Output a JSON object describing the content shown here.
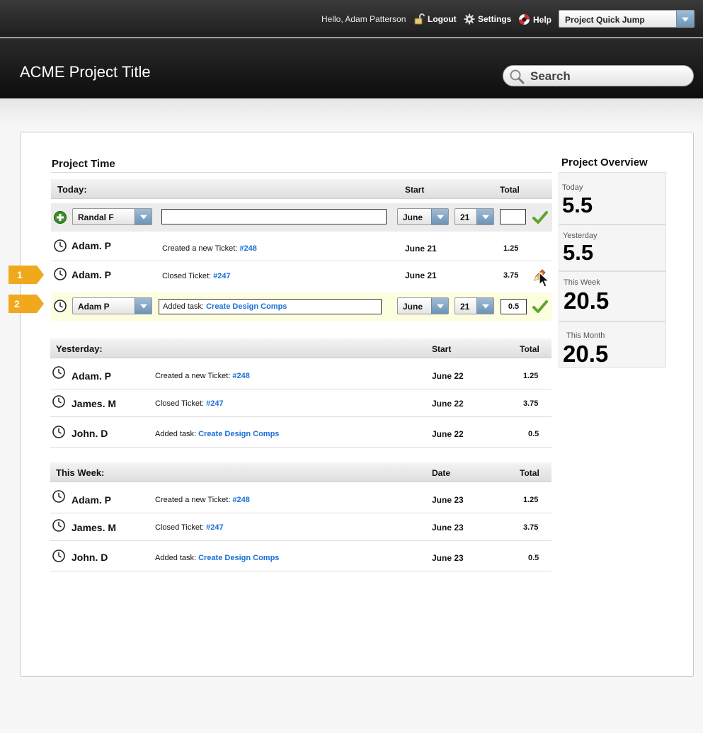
{
  "topbar": {
    "greeting": "Hello, Adam Patterson",
    "logout": "Logout",
    "settings": "Settings",
    "help": "Help",
    "quick_jump": "Project Quick Jump"
  },
  "header": {
    "title": "ACME Project Title",
    "search_placeholder": "Search"
  },
  "time": {
    "title": "Project Time",
    "today": {
      "label": "Today:",
      "col_start": "Start",
      "col_total": "Total",
      "new_entry": {
        "person": "Randal F",
        "description": "",
        "month": "June",
        "day": "21",
        "total": ""
      },
      "rows": [
        {
          "person": "Adam. P",
          "action": "Created a new Ticket:",
          "link": "#248",
          "date": "June 21",
          "total": "1.25"
        },
        {
          "person": "Adam. P",
          "action": "Closed Ticket:",
          "link": "#247",
          "date": "June 21",
          "total": "3.75",
          "marker": "1"
        }
      ],
      "edit_row": {
        "marker": "2",
        "person": "Adam P",
        "action": "Added task:",
        "link": "Create Design Comps",
        "month": "June",
        "day": "21",
        "total": "0.5"
      }
    },
    "yesterday": {
      "label": "Yesterday:",
      "col_start": "Start",
      "col_total": "Total",
      "rows": [
        {
          "person": "Adam. P",
          "action": "Created a new Ticket:",
          "link": "#248",
          "date": "June 22",
          "total": "1.25"
        },
        {
          "person": "James. M",
          "action": "Closed Ticket:",
          "link": "#247",
          "date": "June 22",
          "total": "3.75"
        },
        {
          "person": "John. D",
          "action": "Added task:",
          "link": "Create Design Comps",
          "date": "June 22",
          "total": "0.5"
        }
      ]
    },
    "this_week": {
      "label": "This Week:",
      "col_start": "Date",
      "col_total": "Total",
      "rows": [
        {
          "person": "Adam. P",
          "action": "Created a new Ticket:",
          "link": "#248",
          "date": "June 23",
          "total": "1.25"
        },
        {
          "person": "James. M",
          "action": "Closed Ticket:",
          "link": "#247",
          "date": "June 23",
          "total": "3.75"
        },
        {
          "person": "John. D",
          "action": "Added task:",
          "link": "Create Design Comps",
          "date": "June 23",
          "total": "0.5"
        }
      ]
    }
  },
  "overview": {
    "title": "Project Overview",
    "stats": [
      {
        "label": "Today",
        "value": "5.5"
      },
      {
        "label": "Yesterday",
        "value": "5.5"
      },
      {
        "label": "This Week",
        "value": "20.5"
      },
      {
        "label": "This Month",
        "value": "20.5"
      }
    ]
  },
  "colors": {
    "link": "#1a6fd6",
    "highlight_row": "#fdfde0",
    "marker": "#f0a81c",
    "check": "#5fa32b"
  },
  "icons": [
    "lock-icon",
    "gear-icon",
    "lifebuoy-icon",
    "search-icon",
    "add-icon",
    "clock-icon",
    "check-icon",
    "pencil-icon",
    "cursor-icon"
  ]
}
